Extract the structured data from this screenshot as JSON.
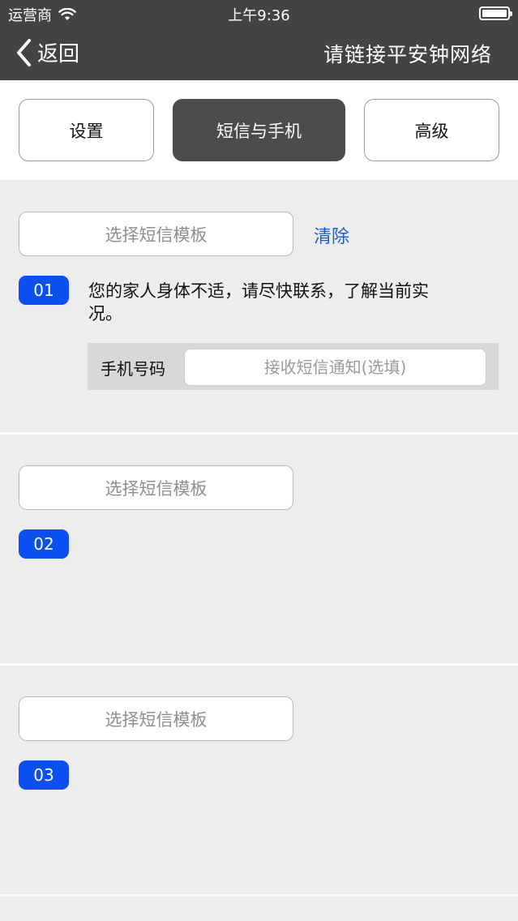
{
  "status_bar": {
    "carrier": "运营商",
    "time": "上午9:36",
    "battery_level": 1.0
  },
  "nav": {
    "back_label": "返回",
    "title": "请链接平安钟网络"
  },
  "tabs": [
    {
      "label": "设置",
      "active": false
    },
    {
      "label": "短信与手机",
      "active": true
    },
    {
      "label": "高级",
      "active": false
    }
  ],
  "slots": [
    {
      "template_placeholder": "选择短信模板",
      "clear_label": "清除",
      "number": "01",
      "message": "您的家人身体不适，请尽快联系，了解当前实况。",
      "phone_label": "手机号码",
      "phone_placeholder": "接收短信通知(选填)"
    },
    {
      "template_placeholder": "选择短信模板",
      "number": "02"
    },
    {
      "template_placeholder": "选择短信模板",
      "number": "03"
    }
  ],
  "colors": {
    "header_bg": "#434345",
    "active_tab_bg": "#4c4b4d",
    "badge_blue": "#0a4ff0",
    "link_blue": "#1a5bd6",
    "page_bg": "#ededee"
  }
}
